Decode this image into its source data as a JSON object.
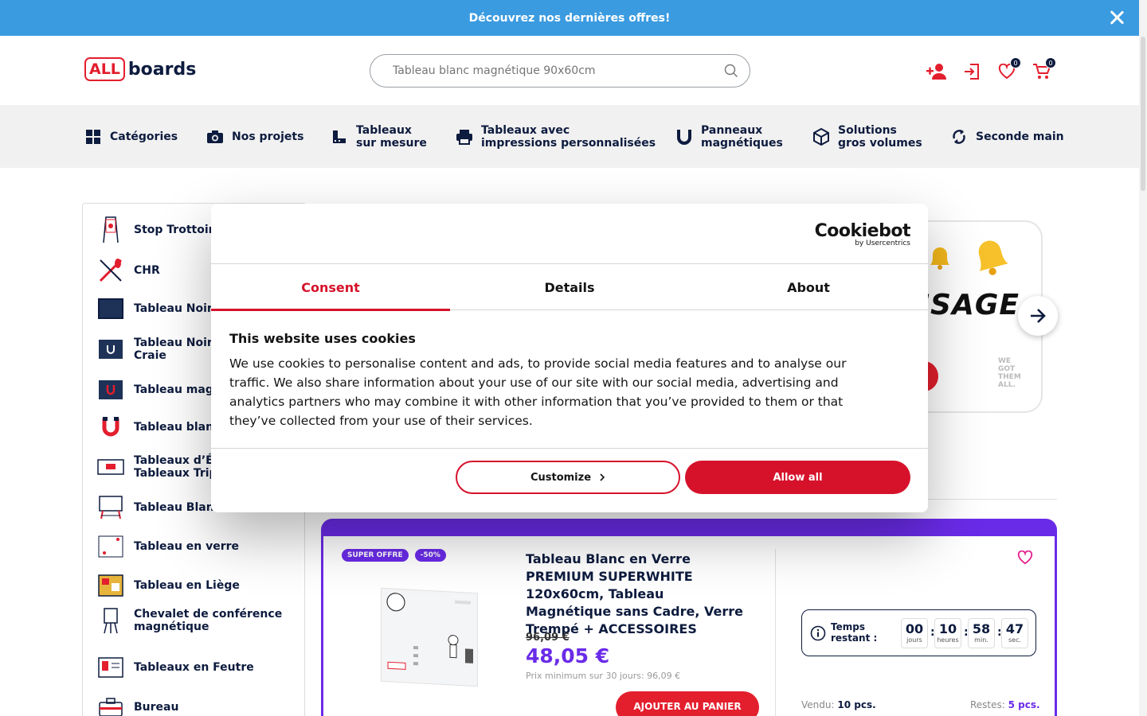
{
  "promo": {
    "text": "Découvrez nos dernières offres!"
  },
  "header": {
    "logo_all": "ALL",
    "logo_boards": "boards",
    "search_placeholder": "Tableau blanc magnétique 90x60cm",
    "wishlist_count": "0",
    "cart_count": "0"
  },
  "nav": {
    "items": [
      {
        "label": "Catégories",
        "icon": "grid-icon"
      },
      {
        "label": "Nos projets",
        "icon": "camera-icon"
      },
      {
        "label_line1": "Tableaux",
        "label_line2": "sur mesure",
        "icon": "ruler-icon"
      },
      {
        "label_line1": "Tableaux avec",
        "label_line2": "impressions personnalisées",
        "icon": "printer-icon"
      },
      {
        "label_line1": "Panneaux",
        "label_line2": "magnétiques",
        "icon": "magnet-icon"
      },
      {
        "label_line1": "Solutions",
        "label_line2": "gros volumes",
        "icon": "box-icon"
      },
      {
        "label": "Seconde main",
        "icon": "recycle-icon"
      }
    ]
  },
  "sidebar": {
    "items": [
      {
        "line1": "Stop Trottoir",
        "line2": ""
      },
      {
        "line1": "CHR",
        "line2": ""
      },
      {
        "line1": "Tableau Noir c",
        "line2": ""
      },
      {
        "line1": "Tableau Noir M",
        "line2": "Craie"
      },
      {
        "line1": "Tableau magn",
        "line2": ""
      },
      {
        "line1": "Tableau blanc",
        "line2": ""
      },
      {
        "line1": "Tableaux d’Éco",
        "line2": "Tableaux Tript"
      },
      {
        "line1": "Tableau Blanc",
        "line2": ""
      },
      {
        "line1": "Tableau en verre",
        "line2": ""
      },
      {
        "line1": "Tableau en Liège",
        "line2": ""
      },
      {
        "line1": "Chevalet de conférence",
        "line2": "magnétique"
      },
      {
        "line1": "Tableaux en Feutre",
        "line2": ""
      },
      {
        "line1": "Bureau",
        "line2": ""
      }
    ]
  },
  "banner": {
    "text": "ISSAGE",
    "note": "WE GOT THEM ALL."
  },
  "product": {
    "tag_offer": "SUPER OFFRE",
    "tag_discount": "-50%",
    "title": "Tableau Blanc en Verre PREMIUM SUPERWHITE 120x60cm, Tableau Magnétique sans Cadre, Verre Trempé + ACCESSOIRES",
    "old_price": "96,09 €",
    "price": "48,05 €",
    "min_price": "Prix minimum sur 30 jours: 96,09 €",
    "add_to_cart": "AJOUTER AU PANIER",
    "timer_label_1": "Temps",
    "timer_label_2": "restant :",
    "timer": [
      {
        "value": "00",
        "unit": "jours"
      },
      {
        "value": "10",
        "unit": "heures"
      },
      {
        "value": "58",
        "unit": "min."
      },
      {
        "value": "47",
        "unit": "sec."
      }
    ],
    "sold_label": "Vendu:",
    "sold_value": "10 pcs.",
    "left_label": "Restes:",
    "left_value": "5 pcs."
  },
  "cookie": {
    "brand": "Cookiebot",
    "brand_sub": "by Usercentrics",
    "tabs": [
      "Consent",
      "Details",
      "About"
    ],
    "active_tab": "Consent",
    "heading": "This website uses cookies",
    "body": "We use cookies to personalise content and ads, to provide social media features and to analyse our traffic. We also share information about your use of our site with our social media, advertising and analytics partners who may combine it with other information that you’ve provided to them or that they’ve collected from your use of their services.",
    "customize_label": "Customize",
    "allow_label": "Allow all"
  },
  "colors": {
    "promo_bg": "#3b9be0",
    "brand_red": "#e31e2d",
    "navy": "#0d1b3e",
    "purple": "#6a2be8",
    "cookie_red": "#d6122b"
  }
}
